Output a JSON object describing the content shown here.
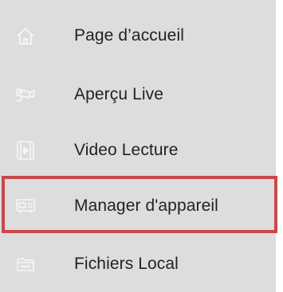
{
  "menu": {
    "items": [
      {
        "label": "Page d’accueil",
        "icon": "home-icon"
      },
      {
        "label": "Aperçu Live",
        "icon": "camera-icon"
      },
      {
        "label": "Video Lecture",
        "icon": "video-playback-icon"
      },
      {
        "label": "Manager d'appareil",
        "icon": "device-icon",
        "highlighted": true
      },
      {
        "label": "Fichiers Local",
        "icon": "folder-icon"
      }
    ]
  },
  "colors": {
    "menu_background": "#dddddd",
    "icon_color": "#f7f7f7",
    "text_color": "#222222",
    "highlight_border": "#c9484c"
  }
}
